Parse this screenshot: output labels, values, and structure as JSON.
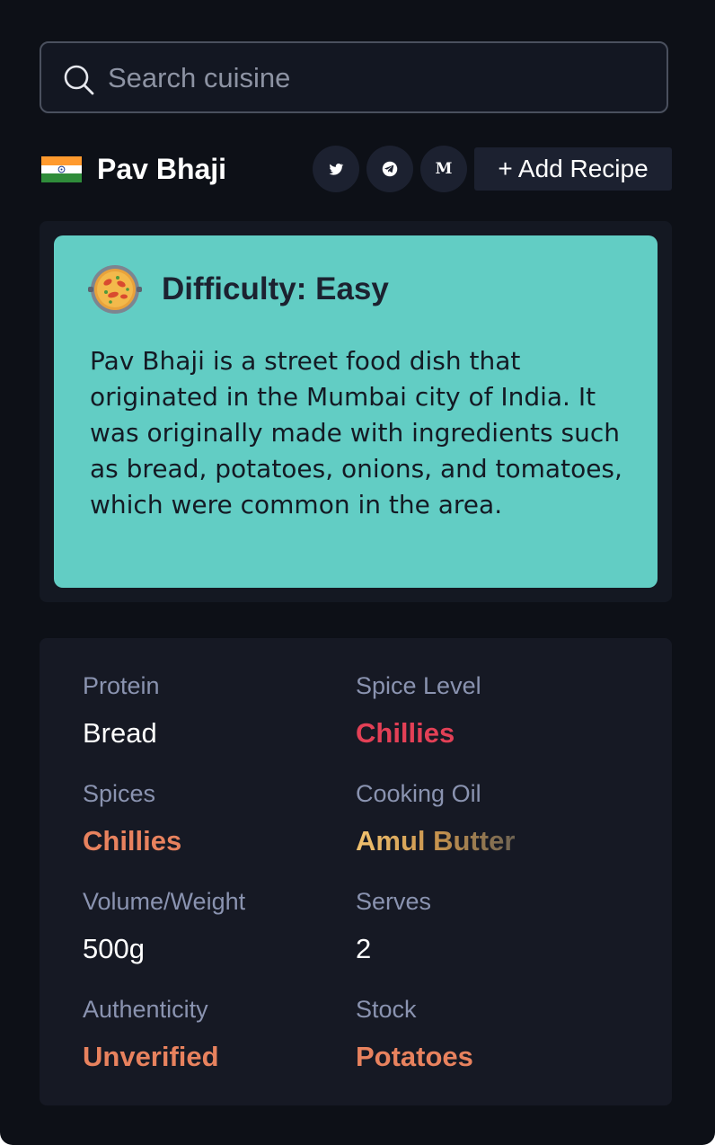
{
  "search": {
    "placeholder": "Search cuisine",
    "icon": "search-icon"
  },
  "header": {
    "flag": "india-flag-icon",
    "title": "Pav Bhaji",
    "social": [
      {
        "name": "twitter-icon"
      },
      {
        "name": "telegram-icon"
      },
      {
        "name": "medium-icon",
        "glyph": "M"
      }
    ],
    "add_recipe_label": "+ Add Recipe"
  },
  "summary": {
    "icon": "paella-pan-icon",
    "difficulty": "Difficulty: Easy",
    "description": "Pav Bhaji is a street food dish that originated in the Mumbai city of India. It was originally made with ingredients such as bread, potatoes, onions, and tomatoes, which were common in the area.",
    "card_color": "#62cdc4"
  },
  "details": {
    "protein": {
      "label": "Protein",
      "value": "Bread"
    },
    "spice_level": {
      "label": "Spice Level",
      "value": "Chillies",
      "color": "#e34056"
    },
    "spices": {
      "label": "Spices",
      "value": "Chillies",
      "color": "#e8825e"
    },
    "cooking_oil": {
      "label": "Cooking Oil",
      "value": "Amul Butter"
    },
    "volume_weight": {
      "label": "Volume/Weight",
      "value": "500g"
    },
    "serves": {
      "label": "Serves",
      "value": "2"
    },
    "authenticity": {
      "label": "Authenticity",
      "value": "Unverified",
      "color": "#e8825e"
    },
    "stock": {
      "label": "Stock",
      "value": "Potatoes",
      "color": "#e8825e"
    }
  }
}
